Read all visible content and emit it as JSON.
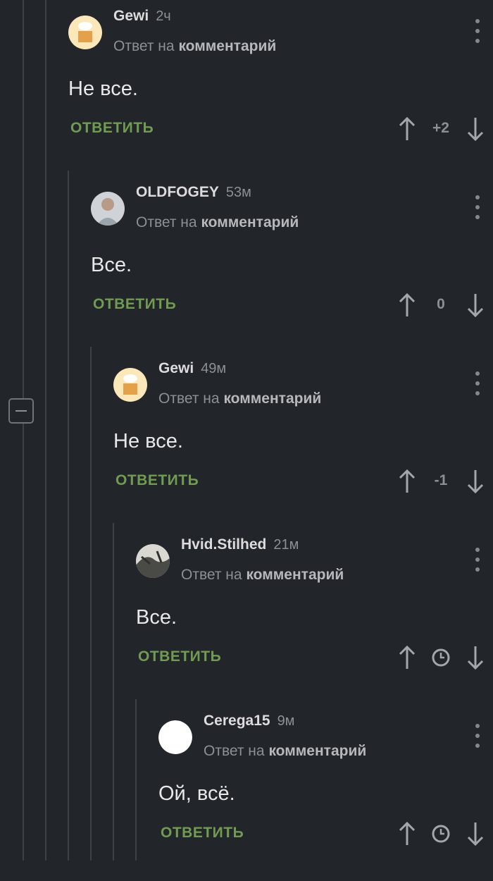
{
  "collapse_label": "−",
  "comments": [
    {
      "author": "Gewi",
      "time": "2ч",
      "reply_prefix": "Ответ на",
      "reply_link": "комментарий",
      "text": "Не все.",
      "reply_label": "ОТВЕТИТЬ",
      "rating": "+2"
    },
    {
      "author": "OLDFOGEY",
      "time": "53м",
      "reply_prefix": "Ответ на",
      "reply_link": "комментарий",
      "text": "Все.",
      "reply_label": "ОТВЕТИТЬ",
      "rating": "0"
    },
    {
      "author": "Gewi",
      "time": "49м",
      "reply_prefix": "Ответ на",
      "reply_link": "комментарий",
      "text": "Не все.",
      "reply_label": "ОТВЕТИТЬ",
      "rating": "-1"
    },
    {
      "author": "Hvid.Stilhed",
      "time": "21м",
      "reply_prefix": "Ответ на",
      "reply_link": "комментарий",
      "text": "Все.",
      "reply_label": "ОТВЕТИТЬ",
      "rating_icon": "clock-icon"
    },
    {
      "author": "Cerega15",
      "time": "9м",
      "reply_prefix": "Ответ на",
      "reply_link": "комментарий",
      "text": "Ой, всё.",
      "reply_label": "ОТВЕТИТЬ",
      "rating_icon": "clock-icon"
    }
  ]
}
